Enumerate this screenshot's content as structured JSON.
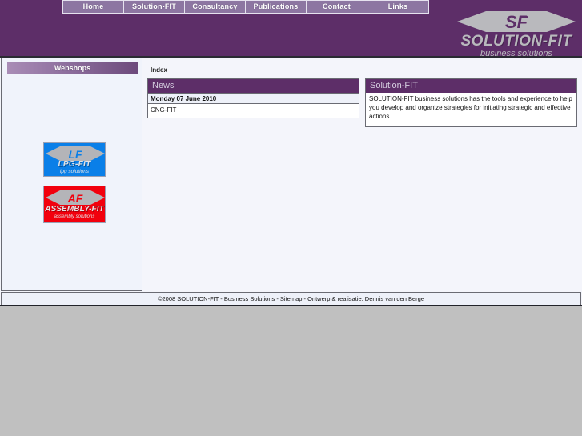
{
  "nav": {
    "items": [
      {
        "label": "Home",
        "name": "nav-item-home"
      },
      {
        "label": "Solution-FIT",
        "name": "nav-item-solution-fit"
      },
      {
        "label": "Consultancy",
        "name": "nav-item-consultancy"
      },
      {
        "label": "Publications",
        "name": "nav-item-publications"
      },
      {
        "label": "Contact",
        "name": "nav-item-contact"
      },
      {
        "label": "Links",
        "name": "nav-item-links"
      }
    ]
  },
  "logo": {
    "icon": "sf-arrow-emblem",
    "main": "SOLUTION-FIT",
    "sub": "business solutions"
  },
  "sidebar": {
    "header": "Webshops",
    "webshops": [
      {
        "main": "LPG-FIT",
        "sub": "lpg solutions",
        "icon": "lf-arrow-emblem",
        "mark": "LF",
        "color": "#0a7fe8"
      },
      {
        "main": "ASSEMBLY-FIT",
        "sub": "assembly solutions",
        "icon": "af-arrow-emblem",
        "mark": "AF",
        "color": "#f2000d"
      }
    ]
  },
  "main": {
    "breadcrumb": "Index",
    "news": {
      "title": "News",
      "date": "Monday 07 June 2010",
      "item": "CNG-FIT"
    },
    "solution": {
      "title": "Solution-FIT",
      "body": "SOLUTION-FIT business solutions has the tools and experience to help you develop and organize strategies for initiating strategic and effective actions."
    }
  },
  "footer": {
    "text": "©2008 SOLUTION-FIT - Business Solutions - Sitemap - Ontwerp & realisatie: Dennis van den Berge"
  },
  "colors": {
    "brand_purple": "#5d2e68",
    "nav_purple": "#8d76a2",
    "page_bg": "#f4f5fb",
    "browser_bg": "#c0c0c0"
  }
}
